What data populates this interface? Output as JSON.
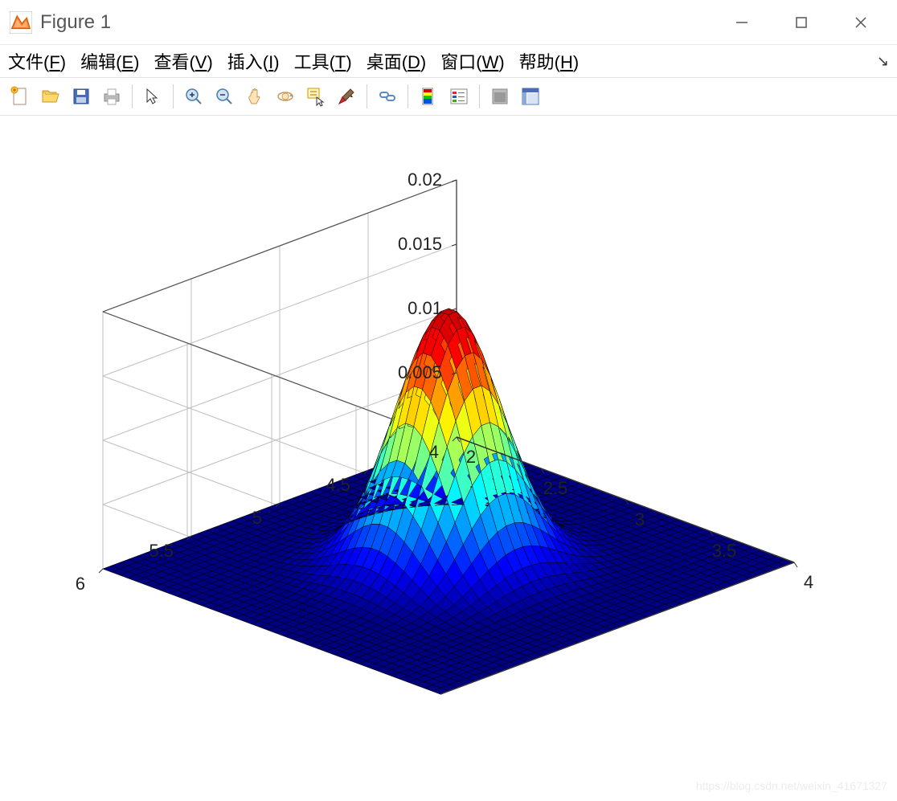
{
  "window": {
    "title": "Figure 1"
  },
  "menu": {
    "file": "文件(F)",
    "edit": "编辑(E)",
    "view": "查看(V)",
    "insert": "插入(I)",
    "tools": "工具(T)",
    "desktop": "桌面(D)",
    "window": "窗口(W)",
    "help": "帮助(H)"
  },
  "toolbar": {
    "tooltips": {
      "new": "New Figure",
      "open": "Open",
      "save": "Save",
      "print": "Print",
      "pointer": "Edit Plot",
      "zoomin": "Zoom In",
      "zoomout": "Zoom Out",
      "pan": "Pan",
      "rotate": "Rotate 3D",
      "datacursor": "Data Cursor",
      "brush": "Brush",
      "link": "Link Plot",
      "colorbar": "Insert Colorbar",
      "legend": "Insert Legend",
      "hide": "Hide Plot Tools",
      "show": "Show Plot Tools"
    }
  },
  "chart_data": {
    "type": "surface",
    "description": "3D Gaussian surface mesh plot",
    "x_range": [
      2,
      4
    ],
    "y_range": [
      4,
      6
    ],
    "z_range": [
      0,
      0.02
    ],
    "x_ticks": [
      2,
      2.5,
      3,
      3.5,
      4
    ],
    "y_ticks": [
      4,
      4.5,
      5,
      5.5,
      6
    ],
    "z_ticks": [
      0.005,
      0.01,
      0.015,
      0.02
    ],
    "peak": {
      "x": 3,
      "y": 5,
      "z": 0.02
    },
    "colormap": "jet",
    "grid_resolution": 41,
    "function": "bivariate gaussian"
  },
  "watermark": "https://blog.csdn.net/weixin_41671327"
}
